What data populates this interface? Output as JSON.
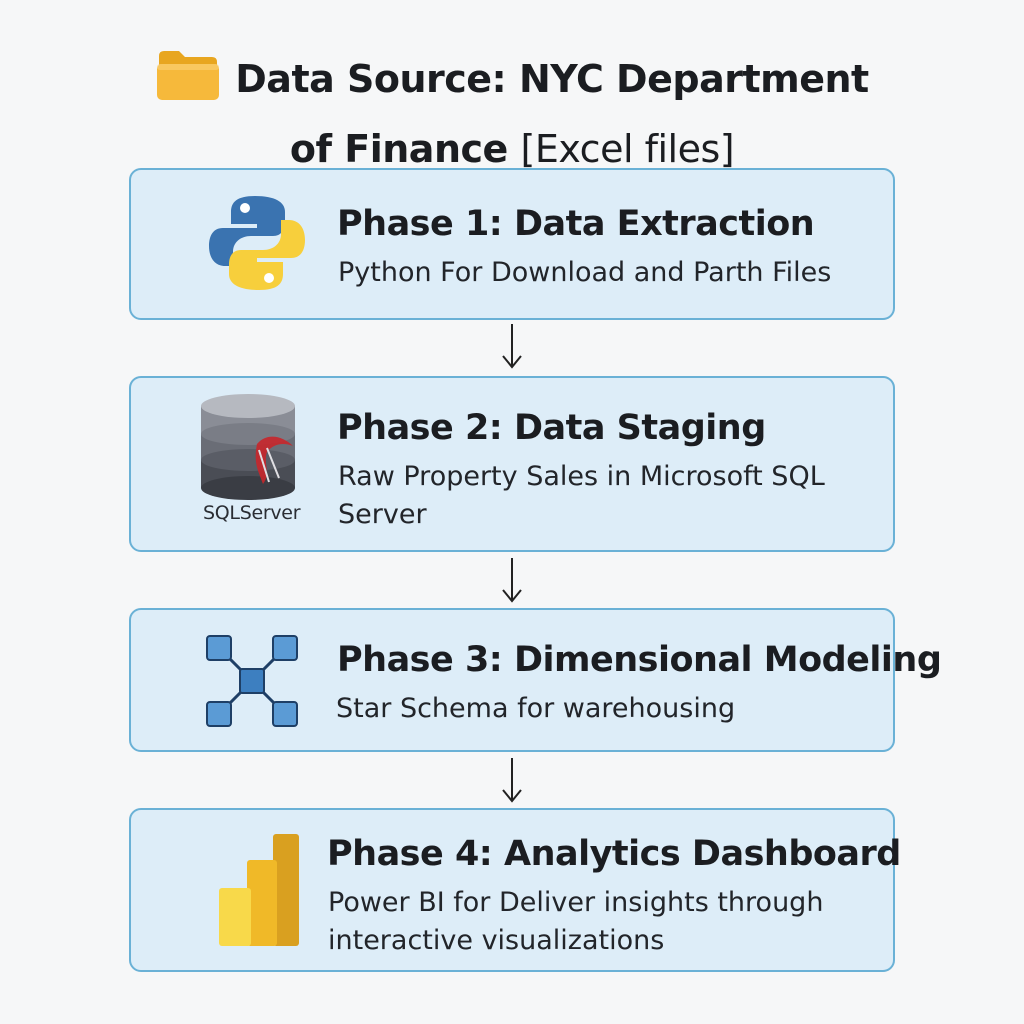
{
  "header": {
    "line1": "Data Source: NYC Department",
    "line2_bold": "of Finance",
    "line2_rest": "[Excel files]",
    "icon": "folder-icon"
  },
  "phases": [
    {
      "title": "Phase 1: Data Extraction",
      "desc": "Python For Download and Parth Files",
      "icon": "python-logo-icon"
    },
    {
      "title": "Phase 2: Data Staging",
      "desc": "Raw Property Sales in Microsoft SQL Server",
      "icon": "sql-server-database-icon",
      "icon_label": "SQLServer"
    },
    {
      "title": "Phase 3: Dimensional Modeling",
      "desc": "Star Schema for warehousing",
      "icon": "star-schema-icon"
    },
    {
      "title": "Phase 4: Analytics Dashboard",
      "desc": "Power BI for Deliver insights through interactive visualizations",
      "icon": "power-bi-logo-icon"
    }
  ],
  "colors": {
    "card_fill": "#ddedf8",
    "card_border": "#6ab1d6",
    "python_blue": "#3a73b0",
    "python_yellow": "#f7cf3c",
    "schema_node": "#5b9bd5",
    "powerbi_yellow": "#f2c811"
  }
}
